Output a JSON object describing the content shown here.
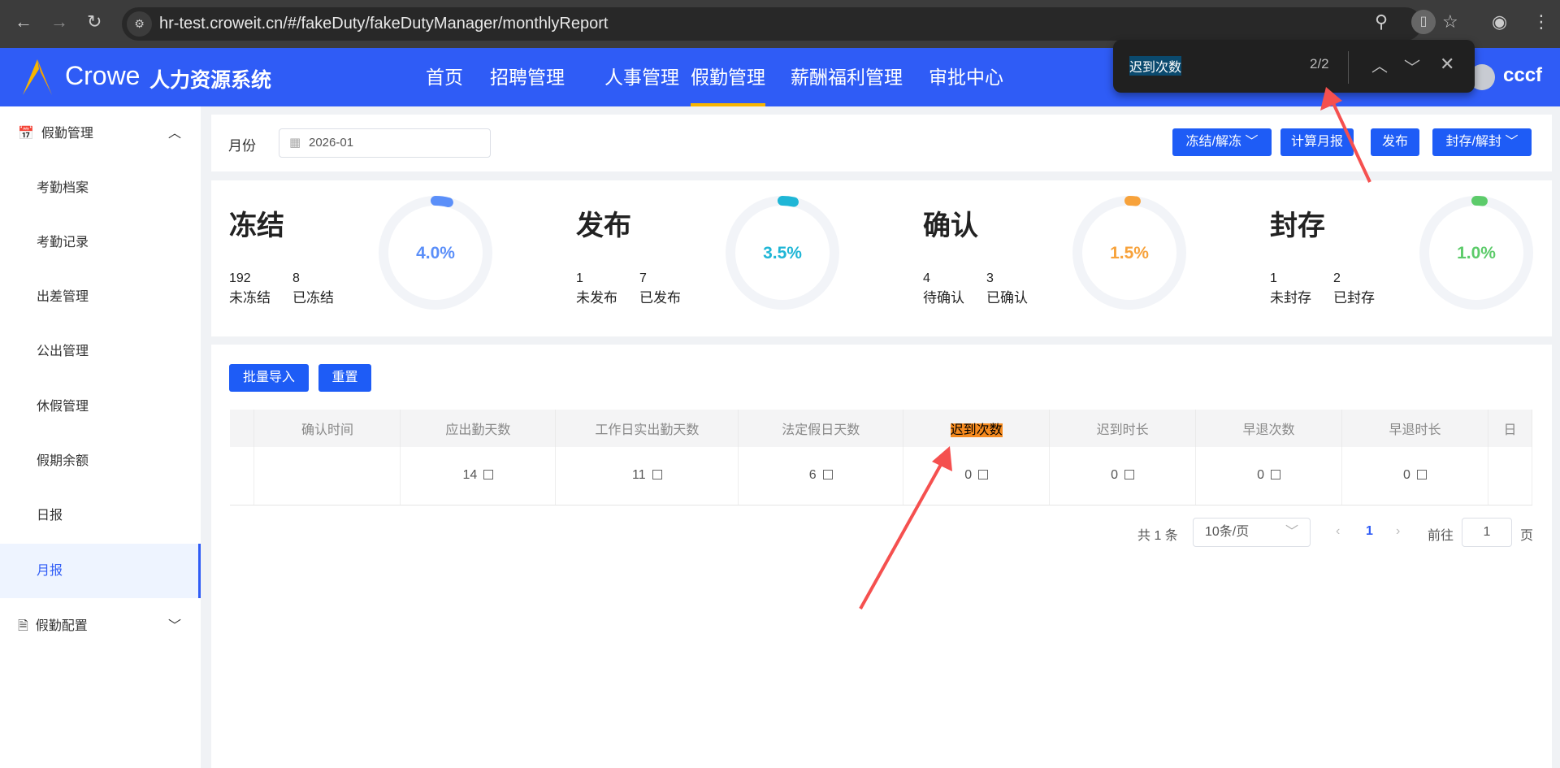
{
  "browser": {
    "url": "hr-test.croweit.cn/#/fakeDuty/fakeDutyManager/monthlyReport"
  },
  "header": {
    "brand": "Crowe",
    "system": "人力资源系统",
    "user": "cccf",
    "nav": [
      {
        "label": "首页"
      },
      {
        "label": "招聘管理"
      },
      {
        "label": "人事管理"
      },
      {
        "label": "假勤管理",
        "active": true
      },
      {
        "label": "薪酬福利管理"
      },
      {
        "label": "审批中心"
      }
    ]
  },
  "find": {
    "query": "迟到次数",
    "count": "2/2"
  },
  "sidebar": {
    "group1": "假勤管理",
    "items": [
      {
        "label": "考勤档案"
      },
      {
        "label": "考勤记录"
      },
      {
        "label": "出差管理"
      },
      {
        "label": "公出管理"
      },
      {
        "label": "休假管理"
      },
      {
        "label": "假期余额"
      },
      {
        "label": "日报"
      },
      {
        "label": "月报",
        "active": true
      }
    ],
    "group2": "假勤配置"
  },
  "filter": {
    "month_label": "月份",
    "month_value": "2026-01",
    "buttons": [
      "冻结/解冻",
      "计算月报",
      "发布",
      "封存/解封"
    ]
  },
  "stats": [
    {
      "title": "冻结",
      "a_num": "192",
      "a_label": "未冻结",
      "b_num": "8",
      "b_label": "已冻结",
      "percent": "4.0%",
      "value": 4.0,
      "color": "#5b8ff9"
    },
    {
      "title": "发布",
      "a_num": "1",
      "a_label": "未发布",
      "b_num": "7",
      "b_label": "已发布",
      "percent": "3.5%",
      "value": 3.5,
      "color": "#1fb6d6"
    },
    {
      "title": "确认",
      "a_num": "4",
      "a_label": "待确认",
      "b_num": "3",
      "b_label": "已确认",
      "percent": "1.5%",
      "value": 1.5,
      "color": "#f7a23b"
    },
    {
      "title": "封存",
      "a_num": "1",
      "a_label": "未封存",
      "b_num": "2",
      "b_label": "已封存",
      "percent": "1.0%",
      "value": 1.0,
      "color": "#5ccb6a"
    }
  ],
  "table": {
    "import": "批量导入",
    "reset": "重置",
    "headers": [
      "",
      "确认时间",
      "应出勤天数",
      "工作日实出勤天数",
      "法定假日天数",
      "迟到次数",
      "迟到时长",
      "早退次数",
      "早退时长",
      "日"
    ],
    "row": [
      "",
      "",
      "14",
      "11",
      "6",
      "0",
      "0",
      "0",
      "0",
      ""
    ]
  },
  "pagination": {
    "total": "共 1 条",
    "page_size": "10条/页",
    "current": "1",
    "goto": "前往",
    "goto_value": "1",
    "page_unit": "页"
  }
}
